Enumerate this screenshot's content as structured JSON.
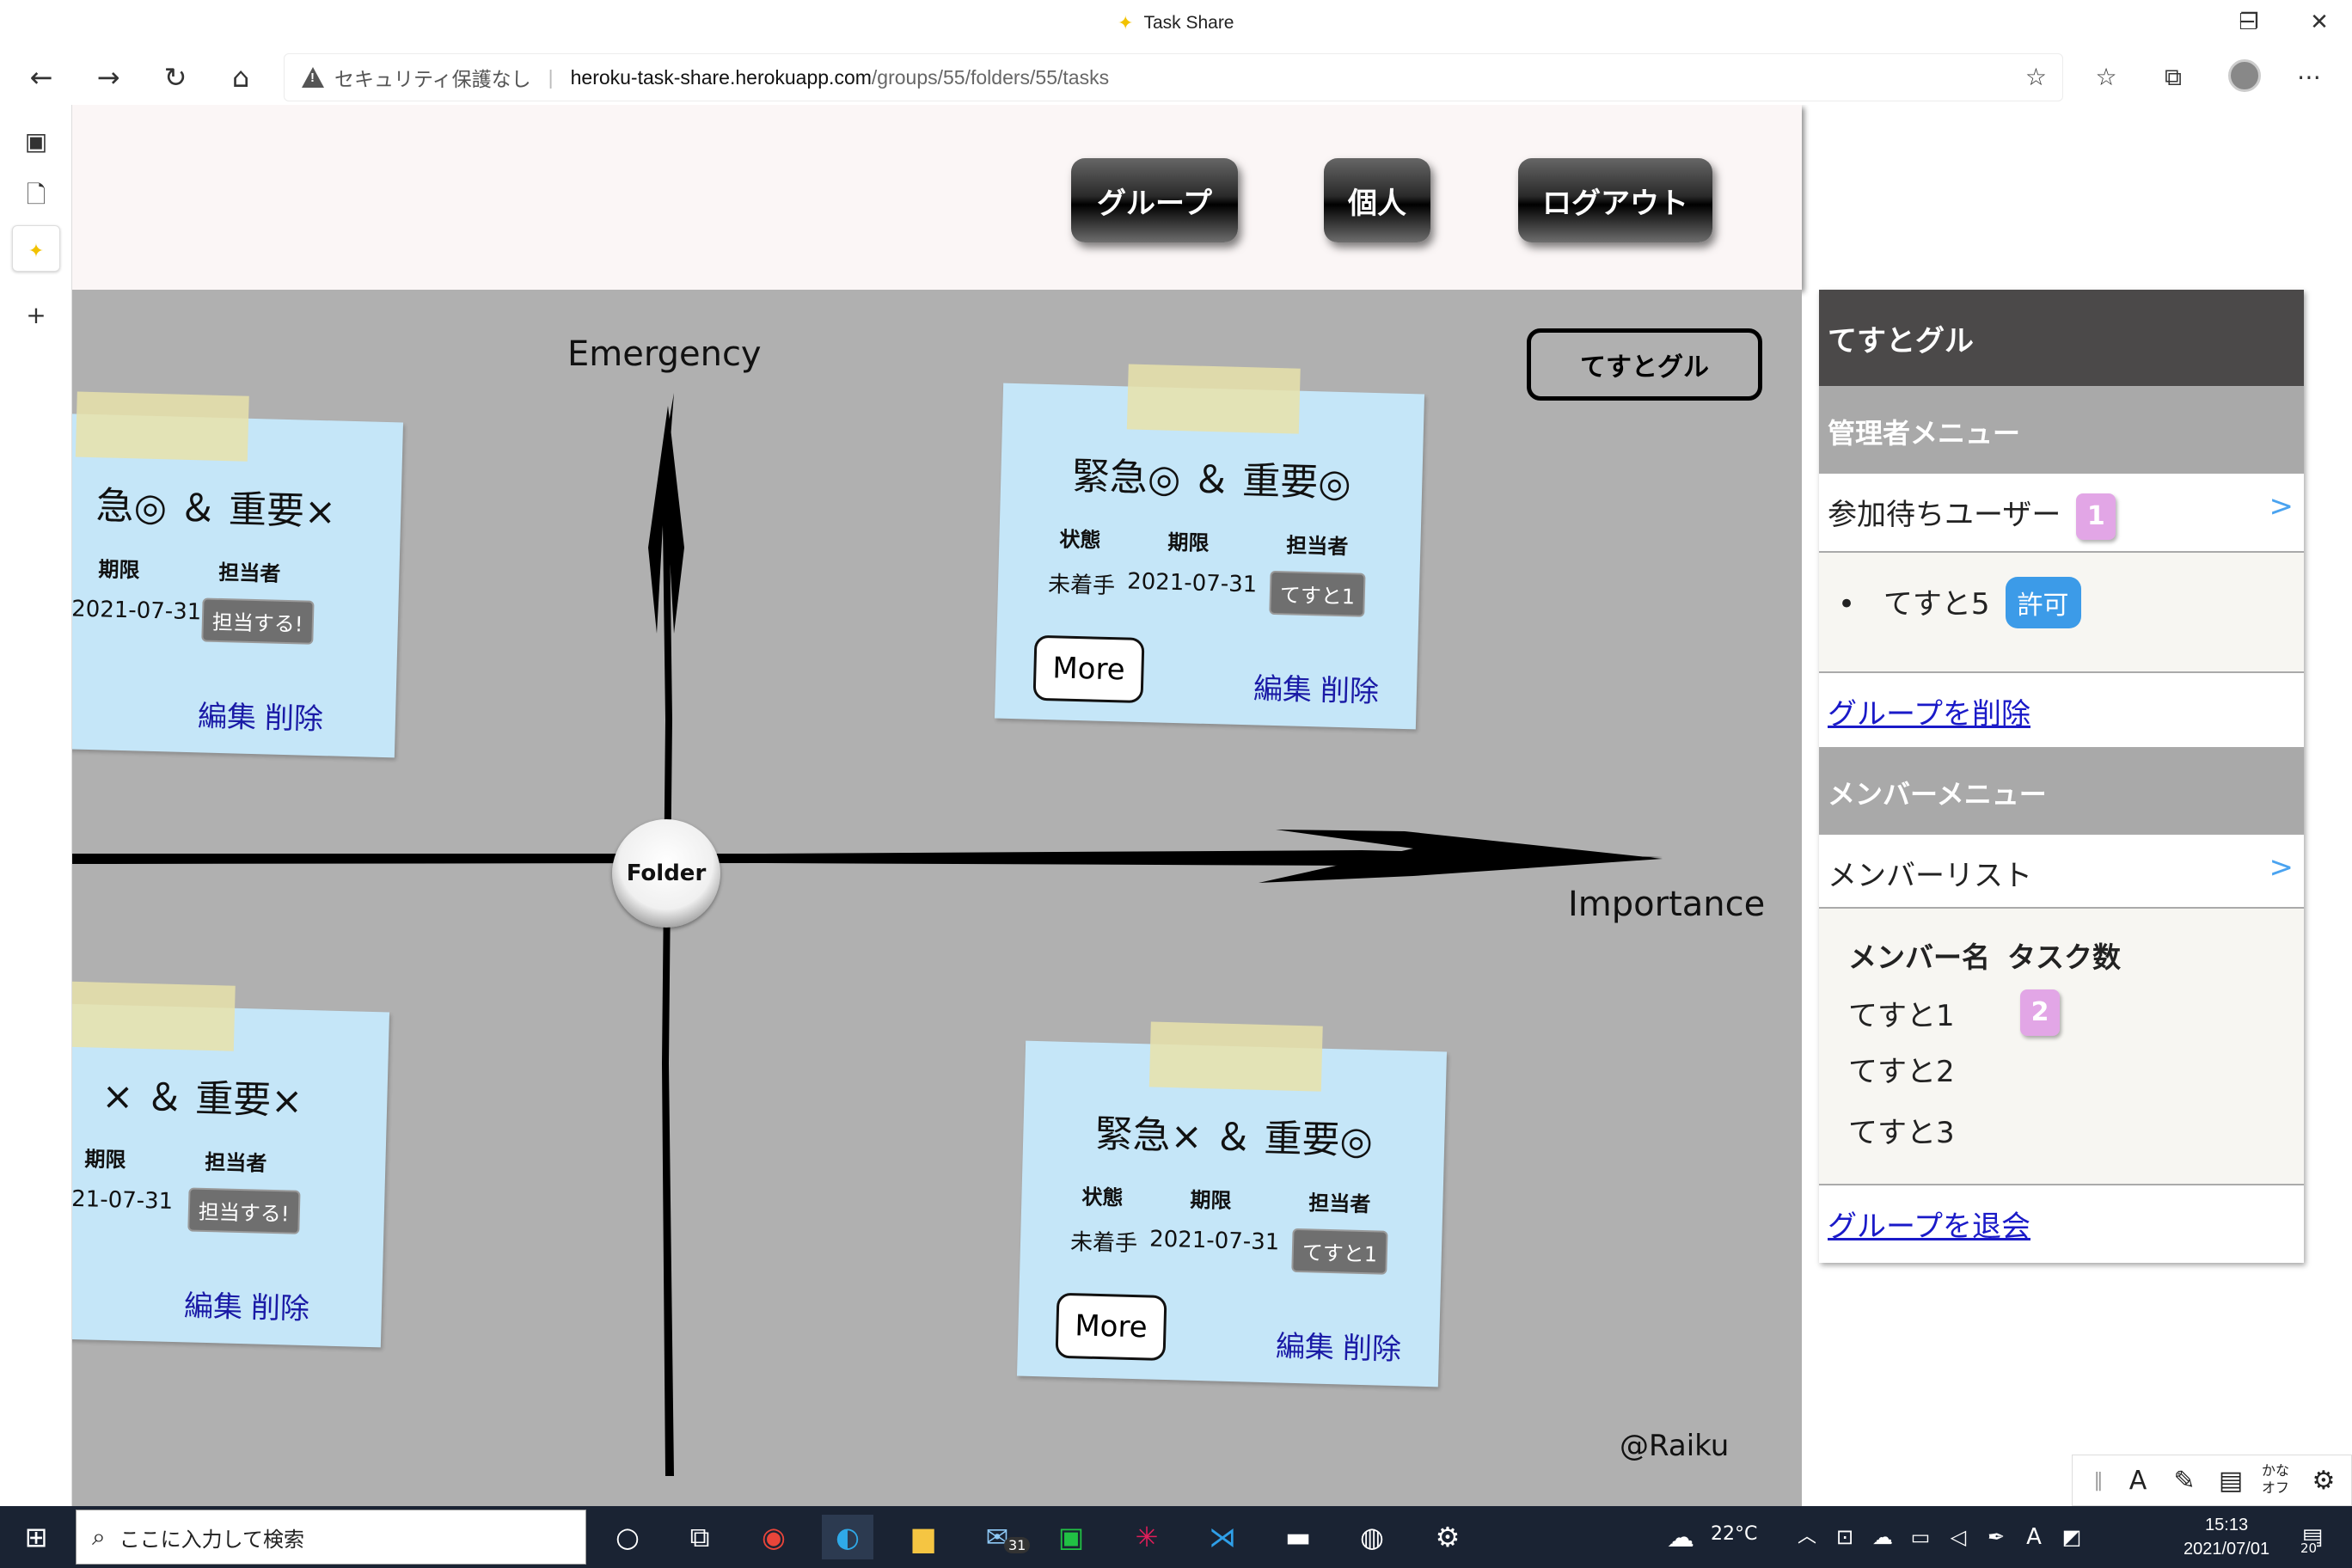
{
  "window": {
    "title": "Task Share",
    "min": "─",
    "max": "❐",
    "close": "✕"
  },
  "browser": {
    "back": "←",
    "forward": "→",
    "reload": "↻",
    "home": "⌂",
    "security": "セキュリティ保護なし",
    "url_host": "heroku-task-share.herokuapp.com",
    "url_path": "/groups/55/folders/55/tasks",
    "icons": [
      "favorite-add-icon",
      "favorites-icon",
      "collections-icon",
      "profile-icon",
      "more-icon"
    ]
  },
  "header": {
    "group_btn": "グループ",
    "personal_btn": "個人",
    "logout_btn": "ログアウト"
  },
  "board": {
    "y_axis": "Emergency",
    "x_axis": "Importance",
    "folder": "Folder",
    "group_name": "てすとグル",
    "credit": "@Raiku"
  },
  "notes": [
    {
      "title": "急◎ ＆ 重要×",
      "h_deadline": "期限",
      "h_assignee": "担当者",
      "deadline": "2021-07-31",
      "assignee": "担当する!",
      "edit": "編集",
      "delete": "削除"
    },
    {
      "title": "緊急◎ ＆ 重要◎",
      "h_status": "状態",
      "h_deadline": "期限",
      "h_assignee": "担当者",
      "status": "未着手",
      "deadline": "2021-07-31",
      "assignee": "てすと1",
      "more": "More",
      "edit": "編集",
      "delete": "削除"
    },
    {
      "title": "× ＆ 重要×",
      "h_deadline": "期限",
      "h_assignee": "担当者",
      "deadline": "21-07-31",
      "assignee": "担当する!",
      "edit": "編集",
      "delete": "削除"
    },
    {
      "title": "緊急× ＆ 重要◎",
      "h_status": "状態",
      "h_deadline": "期限",
      "h_assignee": "担当者",
      "status": "未着手",
      "deadline": "2021-07-31",
      "assignee": "てすと1",
      "more": "More",
      "edit": "編集",
      "delete": "削除"
    }
  ],
  "sidebar": {
    "group_title": "てすとグル",
    "admin_menu": "管理者メニュー",
    "pending_users": "参加待ちユーザー",
    "pending_count": "1",
    "pending_name": "てすと5",
    "permit": "許可",
    "delete_group": "グループを削除",
    "member_menu": "メンバーメニュー",
    "member_list": "メンバーリスト",
    "col_name": "メンバー名",
    "col_tasks": "タスク数",
    "members": [
      {
        "name": "てすと1",
        "tasks": "2"
      },
      {
        "name": "てすと2",
        "tasks": ""
      },
      {
        "name": "てすと3",
        "tasks": ""
      }
    ],
    "leave_group": "グループを退会",
    "chevron": ">"
  },
  "taskbar": {
    "search_placeholder": "ここに入力して検索",
    "weather": "22°C",
    "time": "15:13",
    "date": "2021/07/01",
    "mail_badge": "31",
    "notif_count": "20"
  },
  "ime": {
    "kana": "かな\nオフ"
  },
  "colors": {
    "board": "#b0b0b0",
    "note": "#c5e6f8",
    "sidebar_title": "#4b4949",
    "badge": "#e2a6e6",
    "permit": "#3c9be8"
  }
}
